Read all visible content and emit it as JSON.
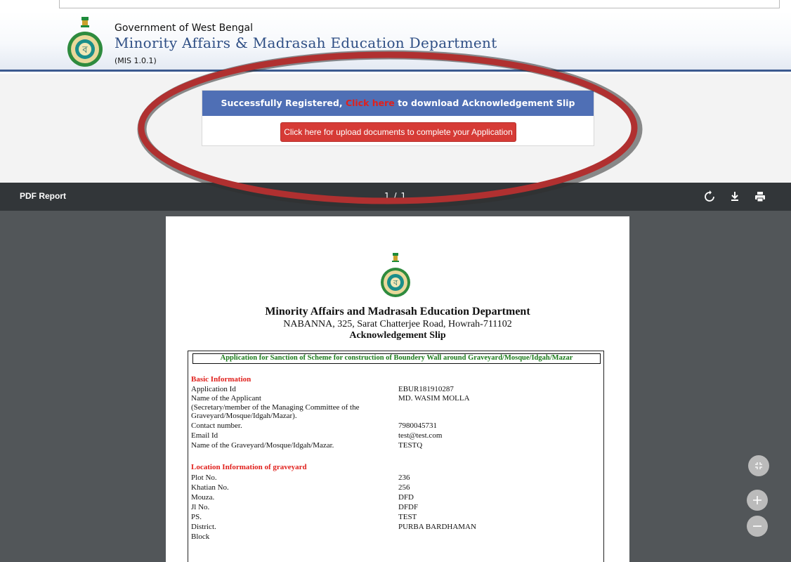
{
  "header": {
    "gov": "Government of West Bengal",
    "dept": "Minority Affairs & Madrasah Education Department",
    "version": "(MIS 1.0.1)"
  },
  "registration": {
    "prefix": "Successfully Registered,",
    "link": "Click here",
    "suffix": "to download Acknowledgement Slip",
    "upload_button": "Click here for upload documents to complete your Application"
  },
  "toolbar": {
    "title": "PDF Report",
    "page": "1 / 1",
    "icons": [
      "rotate-icon",
      "download-icon",
      "print-icon"
    ]
  },
  "document": {
    "title": "Minority Affairs and Madrasah Education Department",
    "address": "NABANNA, 325, Sarat Chatterjee Road, Howrah-711102",
    "subtitle": "Acknowledgement Slip",
    "app_title": "Application for Sanction of Scheme for construction of Boundery Wall around Graveyard/Mosque/Idgah/Mazar",
    "basic": {
      "heading": "Basic Information",
      "rows": [
        {
          "label": "Application Id",
          "value": "EBUR181910287"
        },
        {
          "label": "Name of the Applicant",
          "value": "MD. WASIM MOLLA"
        },
        {
          "label": "(Secretary/member of the Managing Committee of the",
          "value": ""
        },
        {
          "label": "Graveyard/Mosque/Idgah/Mazar).",
          "value": ""
        },
        {
          "label": "Contact number.",
          "value": "7980045731"
        },
        {
          "label": "Email Id",
          "value": "test@test.com"
        },
        {
          "label": "Name of the Graveyard/Mosque/Idgah/Mazar.",
          "value": "TESTQ"
        }
      ]
    },
    "location": {
      "heading": "Location Information of graveyard",
      "rows": [
        {
          "label": "Plot No.",
          "value": "236"
        },
        {
          "label": "Khatian No.",
          "value": "256"
        },
        {
          "label": "Mouza.",
          "value": "DFD"
        },
        {
          "label": "Jl No.",
          "value": "DFDF"
        },
        {
          "label": "PS.",
          "value": "TEST"
        },
        {
          "label": "District.",
          "value": "PURBA BARDHAMAN"
        },
        {
          "label": "Block",
          "value": ""
        }
      ]
    }
  },
  "colors": {
    "header_blue": "#2f4f85",
    "bar_blue": "#4f6fb5",
    "button_red": "#d63b36",
    "link_red": "#e0201c",
    "heading_red": "#e0201c",
    "app_title_green": "#1a7a1a",
    "toolbar": "#323639",
    "viewer": "#525659",
    "annotation_oval": "#b03030"
  },
  "fab_icons": [
    "fit-page-icon",
    "zoom-in-icon",
    "zoom-out-icon"
  ]
}
